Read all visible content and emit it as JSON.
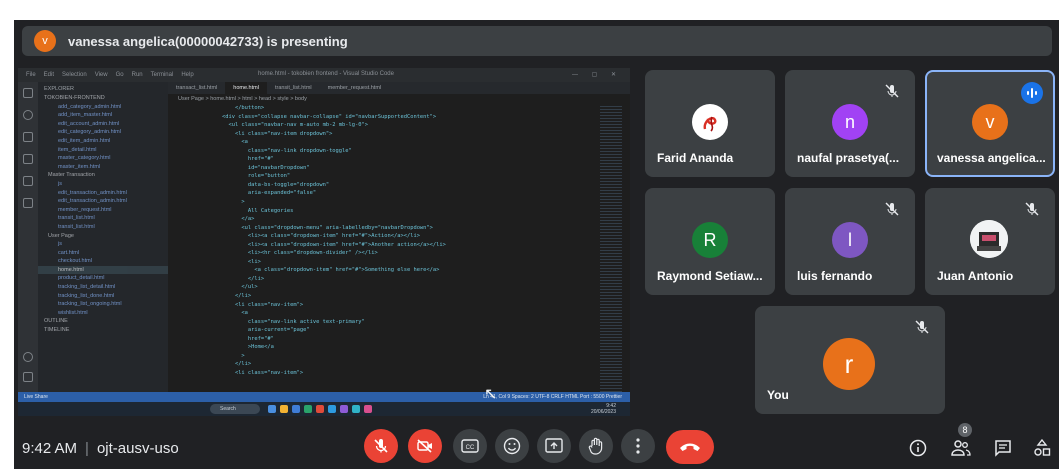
{
  "presentation": {
    "presenter_initial": "v",
    "banner_text": "vanessa angelica(00000042733) is presenting"
  },
  "shared_screen": {
    "window_title": "home.html - tokobien frontend - Visual Studio Code",
    "menu": [
      "File",
      "Edit",
      "Selection",
      "View",
      "Go",
      "Run",
      "Terminal",
      "Help"
    ],
    "explorer_title": "EXPLORER",
    "project": "TOKOBIEN-FRONTEND",
    "files": [
      "add_category_admin.html",
      "add_item_master.html",
      "edit_account_admin.html",
      "edit_category_admin.html",
      "edit_item_admin.html",
      "item_detail.html",
      "master_category.html",
      "master_item.html"
    ],
    "folder_transaction": "Master Transaction",
    "transaction_files": [
      "js",
      "edit_transaction_admin.html",
      "edit_transaction_admin.html",
      "member_request.html",
      "transit_list.html",
      "transit_list.html"
    ],
    "folder_user": "User Page",
    "user_files": [
      "js",
      "cart.html",
      "checkout.html",
      "home.html",
      "product_detail.html",
      "tracking_list_detail.html",
      "tracking_list_done.html",
      "tracking_list_ongoing.html",
      "wishlist.html"
    ],
    "sections": [
      "OUTLINE",
      "TIMELINE"
    ],
    "tabs": [
      "transact_list.html",
      "home.html",
      "transit_list.html",
      "member_request.html"
    ],
    "breadcrumb": "User Page > home.html > html > head > style > body",
    "code_lines": [
      "            </button>",
      "        <div class=\"collapse navbar-collapse\" id=\"navbarSupportedContent\">",
      "          <ul class=\"navbar-nav m-auto mb-2 mb-lg-0\">",
      "            <li class=\"nav-item dropdown\">",
      "              <a",
      "                class=\"nav-link dropdown-toggle\"",
      "                href=\"#\"",
      "                id=\"navbarDropdown\"",
      "                role=\"button\"",
      "                data-bs-toggle=\"dropdown\"",
      "                aria-expanded=\"false\"",
      "              >",
      "                All Categories",
      "              </a>",
      "              <ul class=\"dropdown-menu\" aria-labelledby=\"navbarDropdown\">",
      "                <li><a class=\"dropdown-item\" href=\"#\">Action</a></li>",
      "                <li><a class=\"dropdown-item\" href=\"#\">Another action</a></li>",
      "                <li><hr class=\"dropdown-divider\" /></li>",
      "                <li>",
      "                  <a class=\"dropdown-item\" href=\"#\">Something else here</a>",
      "                </li>",
      "              </ul>",
      "            </li>",
      "            <li class=\"nav-item\">",
      "              <a",
      "                class=\"nav-link active text-primary\"",
      "                aria-current=\"page\"",
      "                href=\"#\"",
      "                >Home</a",
      "              >",
      "            </li>",
      "            <li class=\"nav-item\">"
    ],
    "status_left": "Live Share",
    "status_right": "Ln 41, Col 9   Spaces: 2   UTF-8   CRLF   HTML   Port : 5500   Prettier",
    "taskbar_search": "Search",
    "taskbar_time": "9:42",
    "taskbar_date": "20/06/2023"
  },
  "participants": [
    {
      "name": "Farid Ananda",
      "initial": "",
      "color": "#ffffff",
      "muted": false
    },
    {
      "name": "naufal prasetya(...",
      "initial": "n",
      "color": "#a142f4",
      "muted": true
    },
    {
      "name": "vanessa angelica...",
      "initial": "v",
      "color": "#e8711a",
      "muted": false,
      "speaking": true
    },
    {
      "name": "Raymond Setiaw...",
      "initial": "R",
      "color": "#188038",
      "muted": false
    },
    {
      "name": "luis fernando",
      "initial": "l",
      "color": "#7e57c2",
      "muted": true
    },
    {
      "name": "Juan Antonio",
      "initial": "",
      "color": "#ffffff",
      "muted": true
    },
    {
      "name": "You",
      "initial": "r",
      "color": "#e8711a",
      "muted": true
    }
  ],
  "meeting": {
    "time": "9:42 AM",
    "code": "ojt-ausv-uso",
    "participant_count": "8"
  },
  "controls": [
    "microphone-off",
    "camera-off",
    "captions",
    "reactions",
    "present-screen",
    "raise-hand",
    "more-options",
    "leave-call"
  ],
  "right_controls": [
    "meeting-details",
    "people",
    "chat",
    "activities"
  ],
  "colors": {
    "background": "#202124",
    "tile": "#3c4043",
    "red": "#ea4335",
    "speaking_border": "#8ab4f8"
  }
}
